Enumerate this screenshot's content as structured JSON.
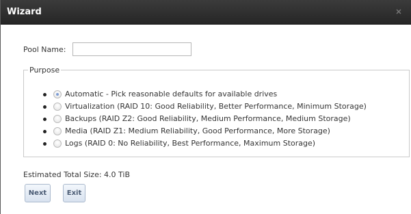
{
  "window": {
    "title": "Wizard"
  },
  "pool": {
    "label": "Pool Name:",
    "value": "",
    "placeholder": ""
  },
  "purpose": {
    "legend": "Purpose",
    "selected": "automatic",
    "options": [
      {
        "id": "automatic",
        "label": "Automatic - Pick reasonable defaults for available drives"
      },
      {
        "id": "virtualization",
        "label": "Virtualization (RAID 10: Good Reliability, Better Performance, Minimum Storage)"
      },
      {
        "id": "backups",
        "label": "Backups (RAID Z2: Good Reliability, Medium Performance, Medium Storage)"
      },
      {
        "id": "media",
        "label": "Media (RAID Z1: Medium Reliability, Good Performance, More Storage)"
      },
      {
        "id": "logs",
        "label": "Logs (RAID 0: No Reliability, Best Performance, Maximum Storage)"
      }
    ]
  },
  "estimate": {
    "text": "Estimated Total Size: 4.0 TiB"
  },
  "buttons": {
    "next": "Next",
    "exit": "Exit"
  },
  "icons": {
    "close": "close-icon"
  },
  "colors": {
    "titlebar": "#2e2e2e",
    "button_text": "#4a5b74"
  }
}
